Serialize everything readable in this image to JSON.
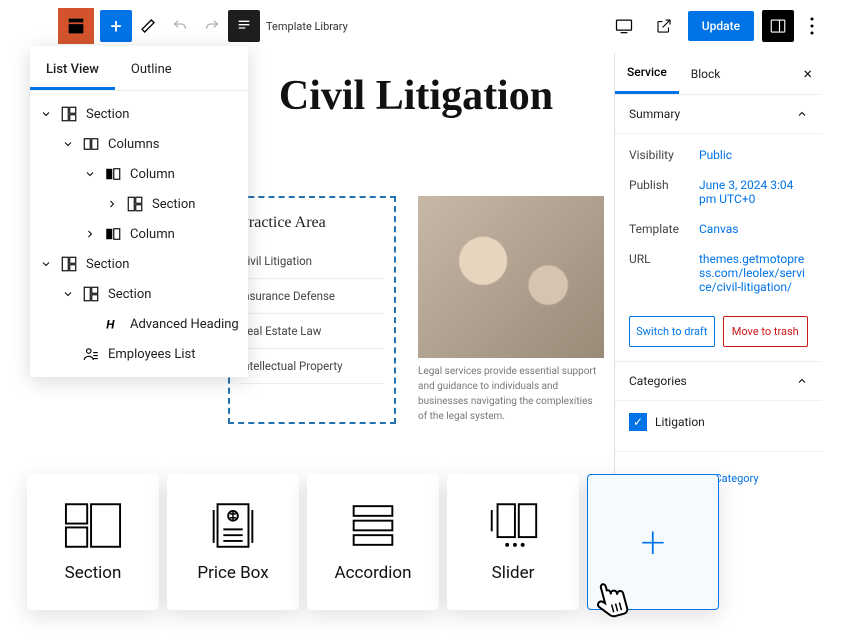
{
  "topbar": {
    "template_lib": "Template Library",
    "update": "Update"
  },
  "listview": {
    "tabs": [
      "List View",
      "Outline"
    ],
    "items": [
      {
        "label": "Section",
        "depth": 0,
        "caret": true,
        "icon": "section"
      },
      {
        "label": "Columns",
        "depth": 1,
        "caret": true,
        "icon": "columns"
      },
      {
        "label": "Column",
        "depth": 2,
        "caret": true,
        "icon": "column"
      },
      {
        "label": "Section",
        "depth": 3,
        "caret": false,
        "icon": "section",
        "rt": true
      },
      {
        "label": "Column",
        "depth": 2,
        "caret": false,
        "icon": "column",
        "rt": true
      },
      {
        "label": "Section",
        "depth": 0,
        "caret": true,
        "icon": "section"
      },
      {
        "label": "Section",
        "depth": 1,
        "caret": true,
        "icon": "section"
      },
      {
        "label": "Advanced Heading",
        "depth": 2,
        "caret": false,
        "icon": "heading"
      },
      {
        "label": "Employees List",
        "depth": 1,
        "caret": false,
        "icon": "people"
      }
    ]
  },
  "page": {
    "title": "Civil Litigation",
    "practice_heading": "Practice Area",
    "practice_items": [
      "Civil Litigation",
      "Insurance Defense",
      "Real Estate Law",
      "Intellectual Property"
    ],
    "caption": "Legal services provide essential support and guidance to individuals and businesses navigating the complexities of the legal system."
  },
  "sidebar": {
    "tabs": [
      "Service",
      "Block"
    ],
    "summary": "Summary",
    "rows": {
      "visibility": {
        "k": "Visibility",
        "v": "Public"
      },
      "publish": {
        "k": "Publish",
        "v": "June 3, 2024 3:04 pm UTC+0"
      },
      "template": {
        "k": "Template",
        "v": "Canvas"
      },
      "url": {
        "k": "URL",
        "v": "themes.getmotopress.com/leolex/service/civil-litigation/"
      }
    },
    "draft": "Switch to draft",
    "trash": "Move to trash",
    "categories": "Categories",
    "cat_litigation": "Litigation",
    "add_cat": "Add New Service Category"
  },
  "blocks": {
    "section": "Section",
    "pricebox": "Price Box",
    "accordion": "Accordion",
    "slider": "Slider"
  }
}
